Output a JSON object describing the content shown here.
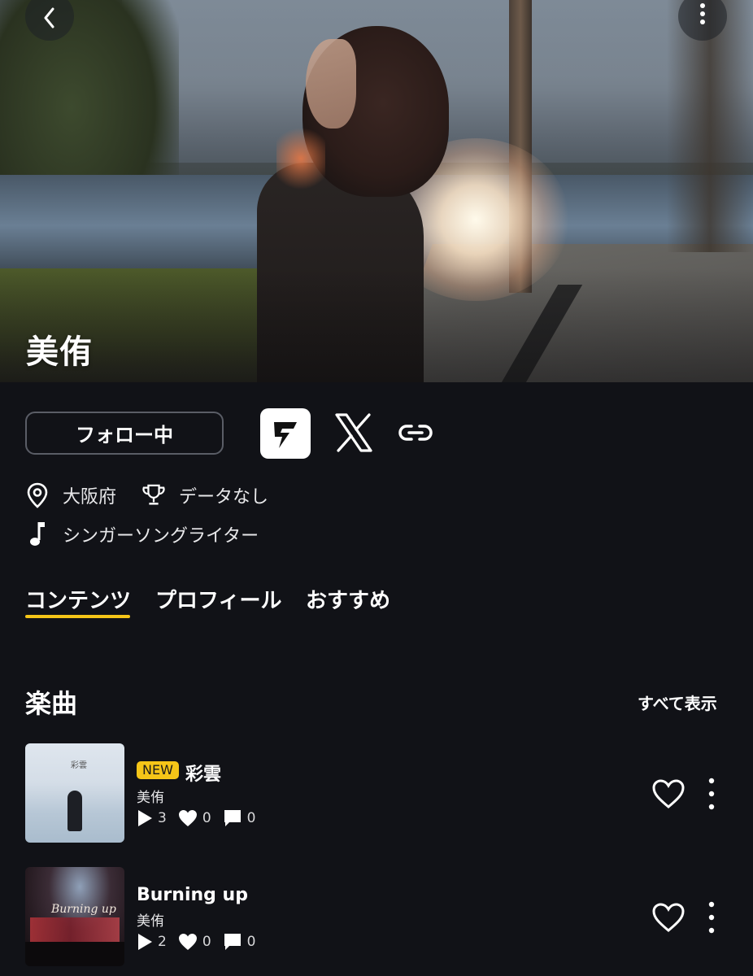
{
  "artist": {
    "name": "美侑",
    "follow_label": "フォロー中",
    "location": "大阪府",
    "award": "データなし",
    "genre": "シンガーソングライター"
  },
  "icons": {
    "back": "chevron-left-icon",
    "more": "more-vertical-icon",
    "app": "app-logo-icon",
    "x": "x-logo-icon",
    "link": "link-icon",
    "location": "location-pin-icon",
    "trophy": "trophy-icon",
    "music": "music-note-icon",
    "play": "play-icon",
    "heart": "heart-icon",
    "comment": "comment-icon"
  },
  "tabs": [
    {
      "label": "コンテンツ",
      "active": true
    },
    {
      "label": "プロフィール",
      "active": false
    },
    {
      "label": "おすすめ",
      "active": false
    }
  ],
  "songs_section": {
    "title": "楽曲",
    "see_all": "すべて表示"
  },
  "songs": [
    {
      "badge": "NEW",
      "title": "彩雲",
      "artist": "美侑",
      "plays": "3",
      "likes": "0",
      "comments": "0",
      "cover_text": "彩雲"
    },
    {
      "badge": "",
      "title": "Burning up",
      "artist": "美侑",
      "plays": "2",
      "likes": "0",
      "comments": "0",
      "cover_text": "Burning up"
    }
  ],
  "colors": {
    "background": "#111217",
    "accent": "#f5c518",
    "button_border": "#5a5d66"
  }
}
